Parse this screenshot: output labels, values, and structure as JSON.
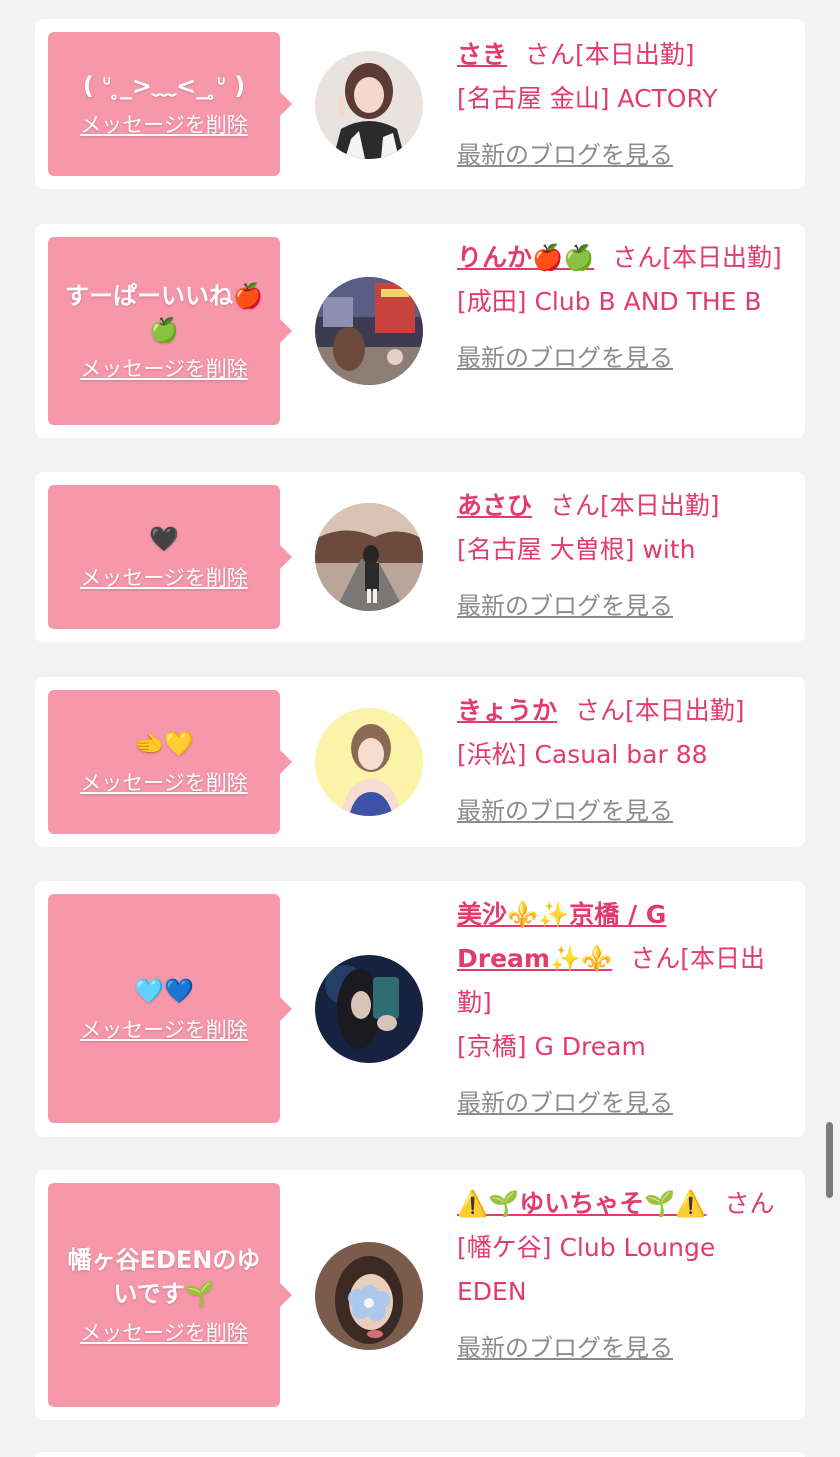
{
  "colors": {
    "background": "#f2f2f2",
    "bubble": "#f797aa",
    "accent": "#e23b6c",
    "blog_link": "#8c8c8c"
  },
  "delete_label": "メッセージを削除",
  "san_suffix": "さん[本日出勤]",
  "blog_label": "最新のブログを見る",
  "messages": [
    {
      "bubble_text": "( ᐡ ̥_>﹏<_ ̥ᐡ )",
      "name": "さき",
      "suffix": "さん[本日出勤]",
      "shop": "[名古屋 金山] ACTORY",
      "avatar_icon": "avatar-photo"
    },
    {
      "bubble_text": "すーぱーいいね🍎🍏",
      "name": "りんか🍎🍏",
      "suffix": "さん[本日出勤]",
      "shop": "[成田] Club B AND THE B",
      "avatar_icon": "avatar-photo"
    },
    {
      "bubble_text": "🖤",
      "name": "あさひ",
      "suffix": "さん[本日出勤]",
      "shop": "[名古屋 大曽根] with",
      "avatar_icon": "avatar-photo"
    },
    {
      "bubble_text": "🫲💛",
      "name": "きょうか",
      "suffix": "さん[本日出勤]",
      "shop": "[浜松] Casual bar 88",
      "avatar_icon": "avatar-photo"
    },
    {
      "bubble_text": "🩵💙",
      "name": "美沙⚜️✨京橋 / G Dream✨⚜️",
      "suffix": "さん[本日出勤]",
      "shop": "[京橋] G Dream",
      "avatar_icon": "avatar-photo"
    },
    {
      "bubble_text": "幡ヶ谷EDENのゆいです🌱",
      "name": "⚠️🌱ゆいちゃそ🌱⚠️",
      "suffix": "さん",
      "shop": "[幡ケ谷] Club Lounge EDEN",
      "avatar_icon": "avatar-photo"
    }
  ]
}
